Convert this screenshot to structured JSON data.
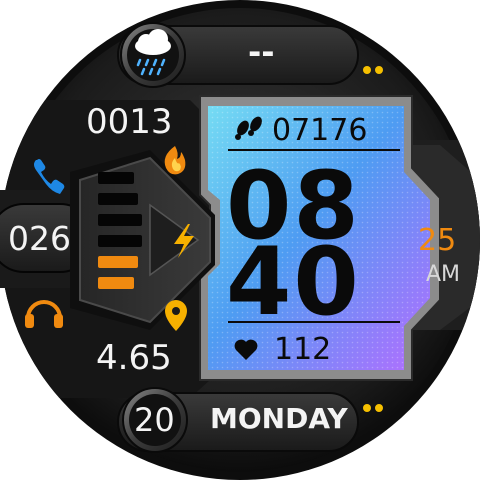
{
  "weather": {
    "icon": "cloud-rain-icon",
    "temperature": "--"
  },
  "calories": "0013",
  "battery": "026",
  "distance": "4.65",
  "steps": "07176",
  "time": {
    "hours": "08",
    "minutes": "40",
    "seconds": "25",
    "ampm": "AM"
  },
  "heart_rate": "112",
  "date": {
    "day": "20",
    "weekday": "MONDAY"
  },
  "colors": {
    "accent": "#f08a10",
    "phone": "#1e88e5",
    "lcd_top": "#6fd6f2",
    "lcd_mid": "#4f92f0",
    "lcd_bottom": "#b06cff",
    "bezel": "#141414",
    "pill": "#2a2a2a",
    "dot_yellow": "#f6c000"
  },
  "battery_gauge": {
    "segments_total": 6,
    "segments_charged": 2
  }
}
